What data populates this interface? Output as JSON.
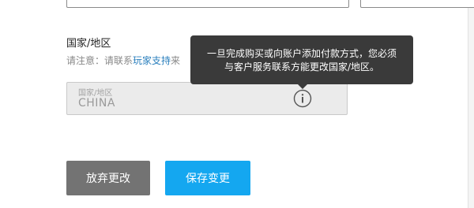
{
  "form": {
    "section_label": "国家/地区",
    "note_prefix": "请注意：请联系",
    "note_link": "玩家支持",
    "note_suffix": "来",
    "country_field": {
      "caption": "国家/地区",
      "value": "CHINA",
      "info_icon": "info-icon"
    }
  },
  "tooltip": {
    "line1": "一旦完成购买或向账户添加付款方式，您必须",
    "line2": "与客户服务联系方能更改国家/地区。"
  },
  "buttons": {
    "discard_label": "放弃更改",
    "save_label": "保存变更"
  },
  "colors": {
    "save_button": "#14a7f0",
    "discard_button": "#737373",
    "tooltip_bg": "#3a3a3a",
    "link": "#2a7fbd"
  }
}
